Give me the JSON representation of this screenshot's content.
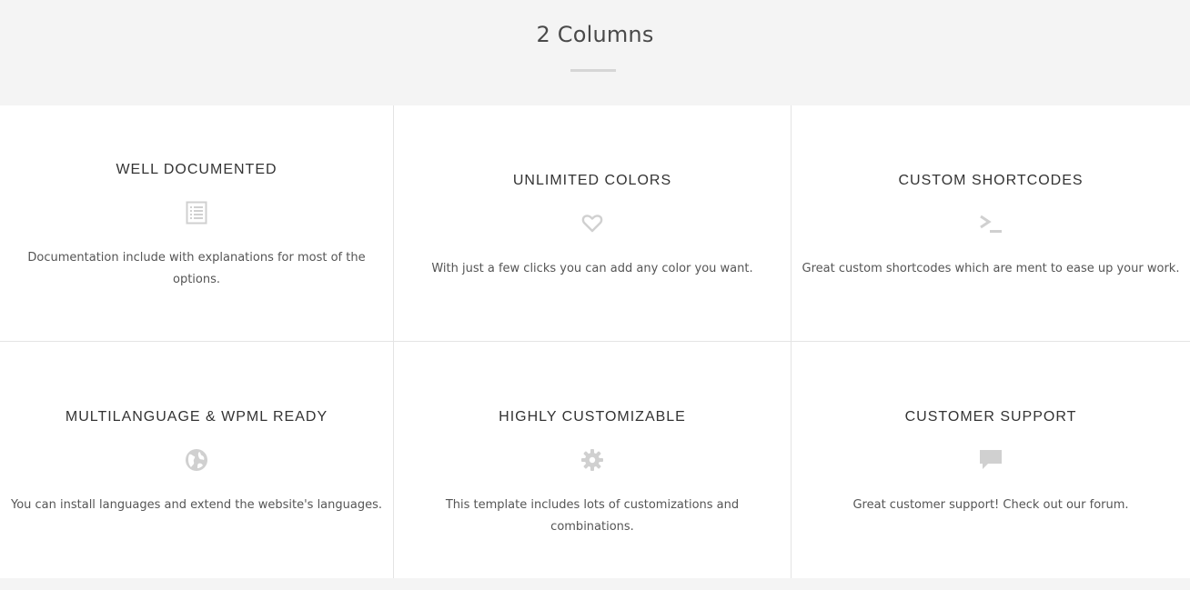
{
  "section": {
    "title": "2 Columns"
  },
  "features": [
    {
      "title": "WELL DOCUMENTED",
      "icon": "document-list-icon",
      "text": "Documentation include with explanations for most of the options."
    },
    {
      "title": "UNLIMITED COLORS",
      "icon": "heart-icon",
      "text": "With just a few clicks you can add any color you want."
    },
    {
      "title": "CUSTOM SHORTCODES",
      "icon": "terminal-icon",
      "text": "Great custom shortcodes which are ment to ease up your work."
    },
    {
      "title": "MULTILANGUAGE & WPML READY",
      "icon": "globe-icon",
      "text": "You can install languages and extend the website's languages."
    },
    {
      "title": "HIGHLY CUSTOMIZABLE",
      "icon": "gear-icon",
      "text": "This template includes lots of customizations and combinations."
    },
    {
      "title": "CUSTOMER SUPPORT",
      "icon": "speech-bubble-icon",
      "text": "Great customer support! Check out our forum."
    }
  ],
  "colors": {
    "background": "#f4f4f4",
    "panel": "#ffffff",
    "icon": "#d0d0d0",
    "heading": "#333333",
    "body_text": "#555555",
    "divider": "#e4e4e4"
  }
}
